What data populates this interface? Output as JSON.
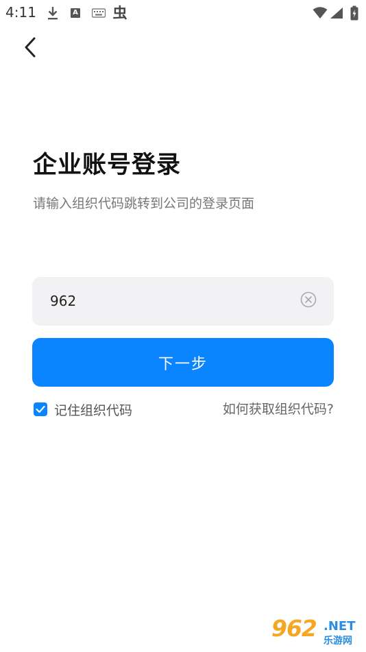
{
  "status_bar": {
    "time": "4:11",
    "icons": [
      "download-icon",
      "keyboard-a-icon",
      "keyboard-icon",
      "bug-icon",
      "wifi-icon",
      "signal-icon",
      "battery-icon"
    ],
    "bug_glyph": "虫"
  },
  "header": {
    "back_icon": "chevron-left-icon"
  },
  "main": {
    "title": "企业账号登录",
    "subtitle": "请输入组织代码跳转到公司的登录页面",
    "org_code_input": {
      "value": "962",
      "clear_icon": "clear-circle-icon"
    },
    "next_button": "下一步",
    "remember": {
      "label": "记住组织代码",
      "checked": true
    },
    "help_link": "如何获取组织代码?"
  },
  "watermark": {
    "number": "962",
    "suffix": ".NET",
    "site_name": "乐游网"
  },
  "colors": {
    "accent": "#0a85ff",
    "input_background": "#f2f2f4",
    "title_text": "#111111",
    "subtitle_text": "#777777"
  }
}
